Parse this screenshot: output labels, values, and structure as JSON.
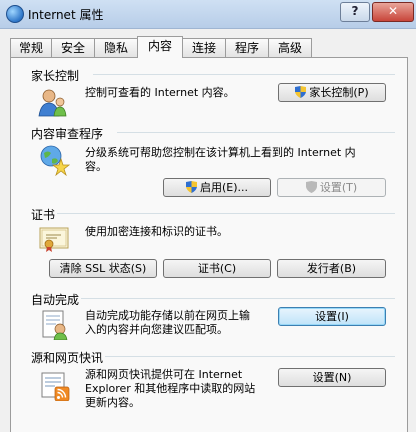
{
  "window": {
    "title": "Internet 属性"
  },
  "tabs": [
    "常规",
    "安全",
    "隐私",
    "内容",
    "连接",
    "程序",
    "高级"
  ],
  "active_tab": "内容",
  "sections": {
    "parental": {
      "title": "家长控制",
      "desc": "控制可查看的 Internet 内容。",
      "button": "家长控制(P)"
    },
    "advisor": {
      "title": "内容审查程序",
      "desc_line1": "分级系统可帮助您控制在该计算机上看到的 Internet 内",
      "desc_line2": "容。",
      "enable_button": "启用(E)...",
      "settings_button": "设置(T)"
    },
    "certificates": {
      "title": "证书",
      "desc": "使用加密连接和标识的证书。",
      "clear_ssl_button": "清除 SSL 状态(S)",
      "certs_button": "证书(C)",
      "publishers_button": "发行者(B)"
    },
    "autocomplete": {
      "title": "自动完成",
      "desc_line1": "自动完成功能存储以前在网页上输",
      "desc_line2": "入的内容并向您建议匹配项。",
      "settings_button": "设置(I)"
    },
    "feeds": {
      "title": "源和网页快讯",
      "desc_line1": "源和网页快讯提供可在 Internet",
      "desc_line2": "Explorer 和其他程序中读取的网站",
      "desc_line3": "更新内容。",
      "settings_button": "设置(N)"
    }
  },
  "icons": [
    "internet-options-icon",
    "parental-control-icon",
    "content-advisor-icon",
    "certificate-icon",
    "autocomplete-icon",
    "feeds-icon",
    "uac-shield-icon"
  ]
}
